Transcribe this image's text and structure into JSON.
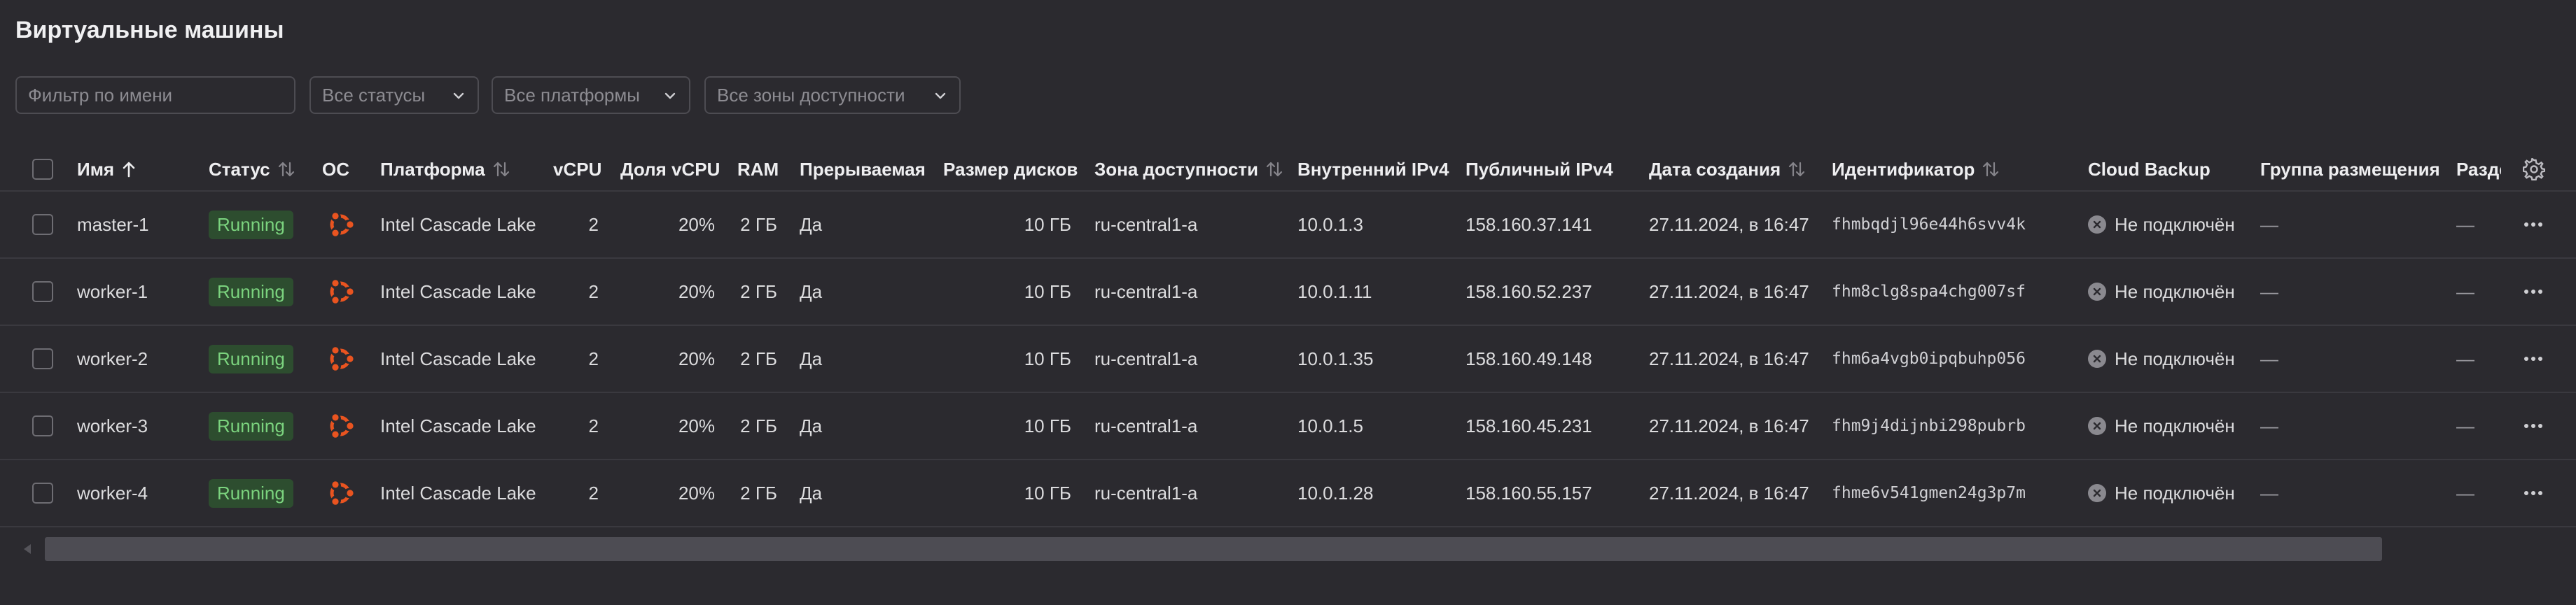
{
  "page": {
    "title": "Виртуальные машины"
  },
  "filters": {
    "name_placeholder": "Фильтр по имени",
    "status": "Все статусы",
    "platform": "Все платформы",
    "zone": "Все зоны доступности"
  },
  "columns": {
    "name": "Имя",
    "status": "Статус",
    "os": "ОС",
    "platform": "Платформа",
    "vcpu": "vCPU",
    "vcpu_share": "Доля vCPU",
    "ram": "RAM",
    "preemptible": "Прерываемая",
    "disk_size": "Размер дисков",
    "zone": "Зона доступности",
    "internal_ipv4": "Внутренний IPv4",
    "public_ipv4": "Публичный IPv4",
    "created": "Дата создания",
    "id": "Идентификатор",
    "backup": "Cloud Backup",
    "placement_group": "Группа размещения",
    "partial": "Разде"
  },
  "rows": [
    {
      "name": "master-1",
      "status": "Running",
      "os": "ubuntu-icon",
      "platform": "Intel Cascade Lake",
      "vcpu": "2",
      "vcpu_share": "20%",
      "ram": "2 ГБ",
      "preemptible": "Да",
      "disk_size": "10 ГБ",
      "zone": "ru-central1-a",
      "internal_ipv4": "10.0.1.3",
      "public_ipv4": "158.160.37.141",
      "created": "27.11.2024, в 16:47",
      "id": "fhmbqdjl96e44h6svv4k",
      "backup": "Не подключён",
      "placement_group": "—",
      "partial": "—"
    },
    {
      "name": "worker-1",
      "status": "Running",
      "os": "ubuntu-icon",
      "platform": "Intel Cascade Lake",
      "vcpu": "2",
      "vcpu_share": "20%",
      "ram": "2 ГБ",
      "preemptible": "Да",
      "disk_size": "10 ГБ",
      "zone": "ru-central1-a",
      "internal_ipv4": "10.0.1.11",
      "public_ipv4": "158.160.52.237",
      "created": "27.11.2024, в 16:47",
      "id": "fhm8clg8spa4chg007sf",
      "backup": "Не подключён",
      "placement_group": "—",
      "partial": "—"
    },
    {
      "name": "worker-2",
      "status": "Running",
      "os": "ubuntu-icon",
      "platform": "Intel Cascade Lake",
      "vcpu": "2",
      "vcpu_share": "20%",
      "ram": "2 ГБ",
      "preemptible": "Да",
      "disk_size": "10 ГБ",
      "zone": "ru-central1-a",
      "internal_ipv4": "10.0.1.35",
      "public_ipv4": "158.160.49.148",
      "created": "27.11.2024, в 16:47",
      "id": "fhm6a4vgb0ipqbuhp056",
      "backup": "Не подключён",
      "placement_group": "—",
      "partial": "—"
    },
    {
      "name": "worker-3",
      "status": "Running",
      "os": "ubuntu-icon",
      "platform": "Intel Cascade Lake",
      "vcpu": "2",
      "vcpu_share": "20%",
      "ram": "2 ГБ",
      "preemptible": "Да",
      "disk_size": "10 ГБ",
      "zone": "ru-central1-a",
      "internal_ipv4": "10.0.1.5",
      "public_ipv4": "158.160.45.231",
      "created": "27.11.2024, в 16:47",
      "id": "fhm9j4dijnbi298pubrb",
      "backup": "Не подключён",
      "placement_group": "—",
      "partial": "—"
    },
    {
      "name": "worker-4",
      "status": "Running",
      "os": "ubuntu-icon",
      "platform": "Intel Cascade Lake",
      "vcpu": "2",
      "vcpu_share": "20%",
      "ram": "2 ГБ",
      "preemptible": "Да",
      "disk_size": "10 ГБ",
      "zone": "ru-central1-a",
      "internal_ipv4": "10.0.1.28",
      "public_ipv4": "158.160.55.157",
      "created": "27.11.2024, в 16:47",
      "id": "fhme6v541gmen24g3p7m",
      "backup": "Не подключён",
      "placement_group": "—",
      "partial": "—"
    }
  ],
  "colors": {
    "background": "#2b2a2f",
    "running_badge_bg": "#2d4d2f",
    "running_badge_text": "#7bd37e",
    "ubuntu_orange": "#e95420"
  },
  "icons": {
    "sort": "sort-icon",
    "sort_asc": "arrow-up-icon",
    "settings": "gear-icon",
    "row_menu": "more-horizontal-icon",
    "backup_off": "x-circle-icon",
    "dropdown": "chevron-down-icon"
  }
}
